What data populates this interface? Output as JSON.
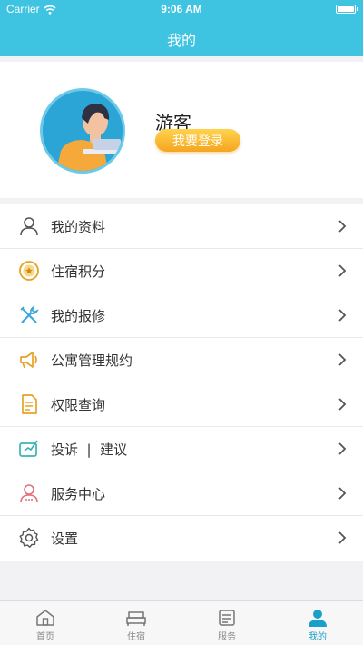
{
  "status_bar": {
    "carrier": "Carrier",
    "time": "9:06 AM"
  },
  "nav": {
    "title": "我的"
  },
  "profile": {
    "username": "游客",
    "login_label": "我要登录",
    "avatar_icon": "user-avatar-illustration"
  },
  "menu": {
    "items": [
      {
        "label": "我的资料",
        "icon": "person-icon"
      },
      {
        "label": "住宿积分",
        "icon": "points-icon"
      },
      {
        "label": "我的报修",
        "icon": "tools-icon"
      },
      {
        "label": "公寓管理规约",
        "icon": "megaphone-icon"
      },
      {
        "label": "权限查询",
        "icon": "document-icon"
      },
      {
        "label": "投诉  |  建议",
        "icon": "feedback-icon"
      },
      {
        "label": "服务中心",
        "icon": "service-icon"
      },
      {
        "label": "设置",
        "icon": "gear-icon"
      }
    ]
  },
  "tabbar": {
    "tabs": [
      {
        "label": "首页",
        "icon": "home-icon"
      },
      {
        "label": "住宿",
        "icon": "bed-icon"
      },
      {
        "label": "服务",
        "icon": "service-list-icon"
      },
      {
        "label": "我的",
        "icon": "profile-icon",
        "active": true
      }
    ]
  },
  "colors": {
    "accent": "#3ec3e0",
    "login_gradient": [
      "#ffd34d",
      "#f5a51f"
    ],
    "tab_active": "#1a9fcb"
  }
}
